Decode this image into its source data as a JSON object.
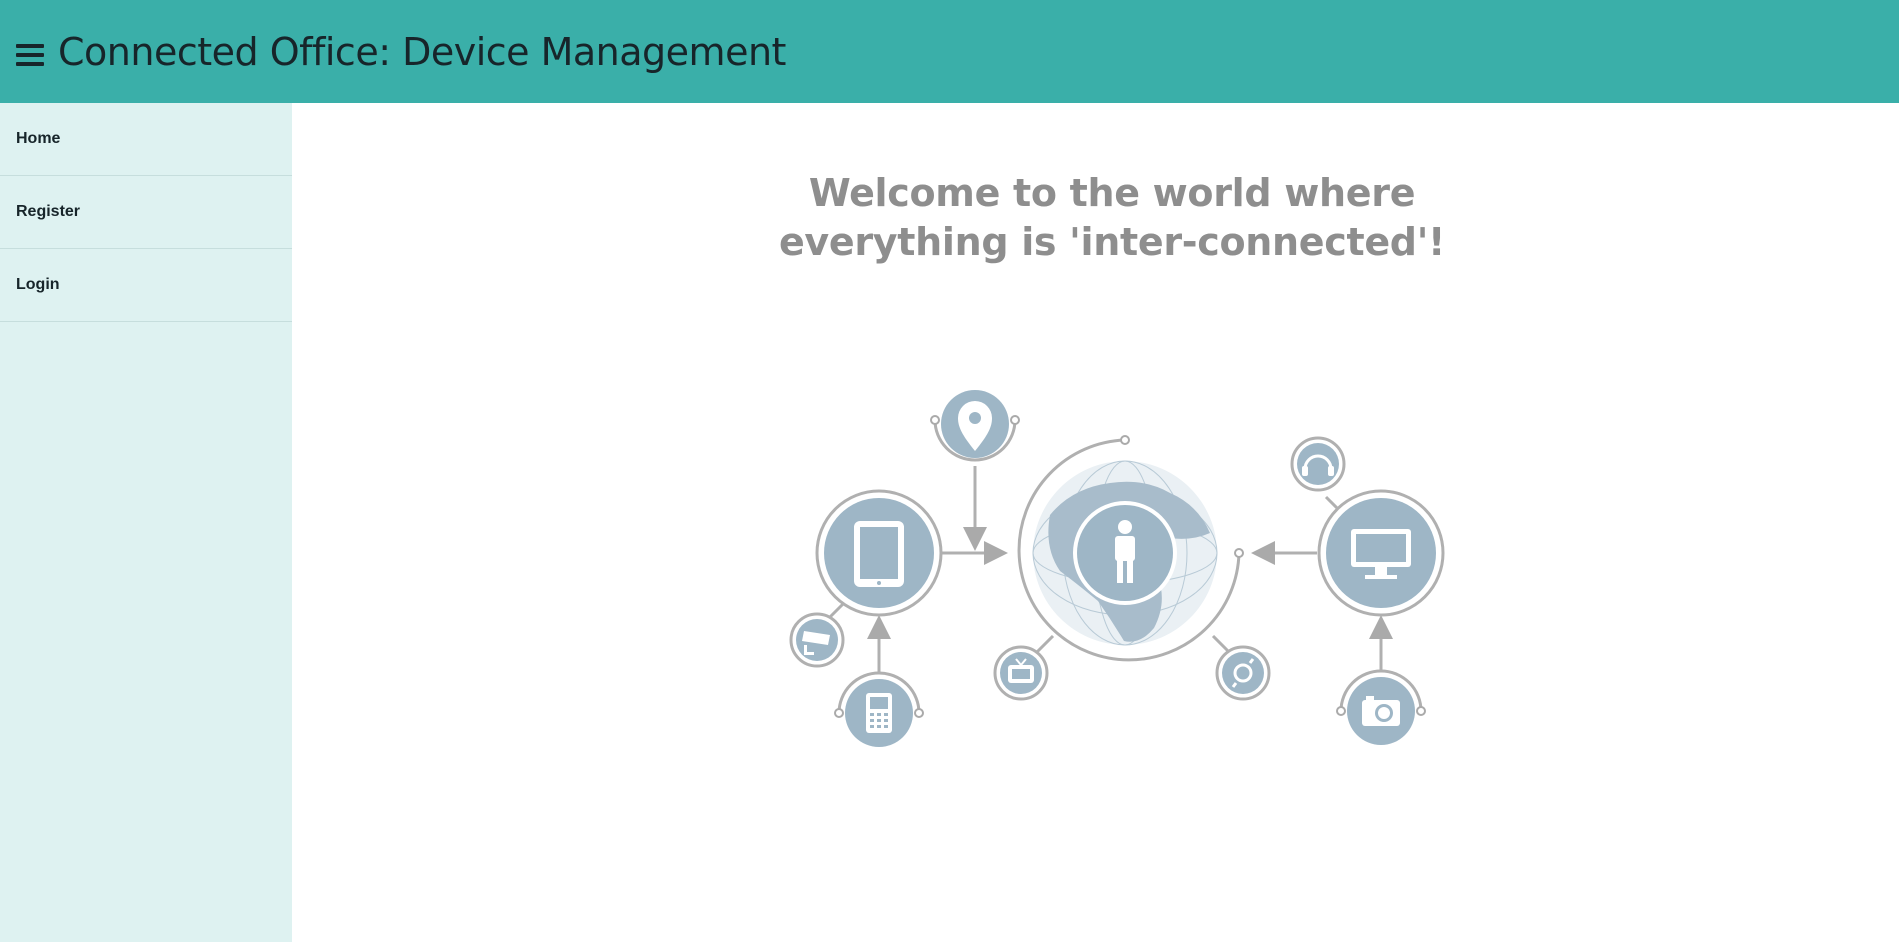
{
  "header": {
    "title": "Connected Office: Device Management",
    "menu_icon": "hamburger-menu-icon",
    "background": "#3aafa9"
  },
  "sidebar": {
    "background": "#def2f1",
    "items": [
      {
        "label": "Home"
      },
      {
        "label": "Register"
      },
      {
        "label": "Login"
      }
    ]
  },
  "main": {
    "welcome_line1": "Welcome to the world where",
    "welcome_line2": "everything is 'inter-connected'!",
    "illustration": {
      "icons": [
        "location-pin-icon",
        "tablet-icon",
        "globe-icon",
        "person-icon",
        "monitor-icon",
        "headphones-icon",
        "cctv-camera-icon",
        "mobile-phone-icon",
        "tv-icon",
        "watch-icon",
        "photo-camera-icon"
      ],
      "circle_color": "#9eb6c6",
      "ring_color": "#b0b0b0"
    }
  }
}
